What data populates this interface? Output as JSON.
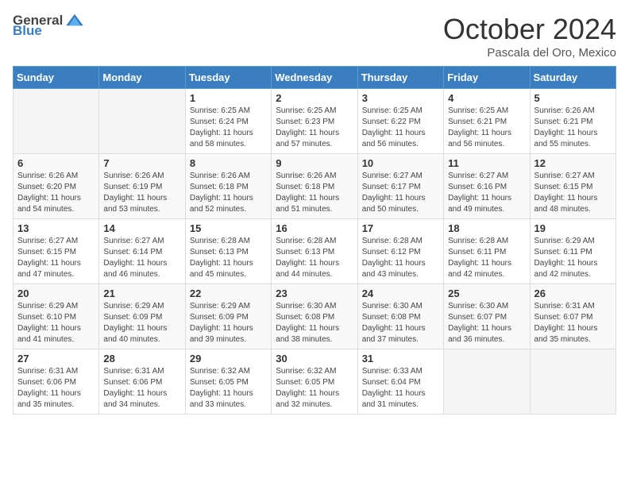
{
  "header": {
    "logo_general": "General",
    "logo_blue": "Blue",
    "month_title": "October 2024",
    "location": "Pascala del Oro, Mexico"
  },
  "days_of_week": [
    "Sunday",
    "Monday",
    "Tuesday",
    "Wednesday",
    "Thursday",
    "Friday",
    "Saturday"
  ],
  "weeks": [
    [
      {
        "day": "",
        "info": ""
      },
      {
        "day": "",
        "info": ""
      },
      {
        "day": "1",
        "info": "Sunrise: 6:25 AM\nSunset: 6:24 PM\nDaylight: 11 hours and 58 minutes."
      },
      {
        "day": "2",
        "info": "Sunrise: 6:25 AM\nSunset: 6:23 PM\nDaylight: 11 hours and 57 minutes."
      },
      {
        "day": "3",
        "info": "Sunrise: 6:25 AM\nSunset: 6:22 PM\nDaylight: 11 hours and 56 minutes."
      },
      {
        "day": "4",
        "info": "Sunrise: 6:25 AM\nSunset: 6:21 PM\nDaylight: 11 hours and 56 minutes."
      },
      {
        "day": "5",
        "info": "Sunrise: 6:26 AM\nSunset: 6:21 PM\nDaylight: 11 hours and 55 minutes."
      }
    ],
    [
      {
        "day": "6",
        "info": "Sunrise: 6:26 AM\nSunset: 6:20 PM\nDaylight: 11 hours and 54 minutes."
      },
      {
        "day": "7",
        "info": "Sunrise: 6:26 AM\nSunset: 6:19 PM\nDaylight: 11 hours and 53 minutes."
      },
      {
        "day": "8",
        "info": "Sunrise: 6:26 AM\nSunset: 6:18 PM\nDaylight: 11 hours and 52 minutes."
      },
      {
        "day": "9",
        "info": "Sunrise: 6:26 AM\nSunset: 6:18 PM\nDaylight: 11 hours and 51 minutes."
      },
      {
        "day": "10",
        "info": "Sunrise: 6:27 AM\nSunset: 6:17 PM\nDaylight: 11 hours and 50 minutes."
      },
      {
        "day": "11",
        "info": "Sunrise: 6:27 AM\nSunset: 6:16 PM\nDaylight: 11 hours and 49 minutes."
      },
      {
        "day": "12",
        "info": "Sunrise: 6:27 AM\nSunset: 6:15 PM\nDaylight: 11 hours and 48 minutes."
      }
    ],
    [
      {
        "day": "13",
        "info": "Sunrise: 6:27 AM\nSunset: 6:15 PM\nDaylight: 11 hours and 47 minutes."
      },
      {
        "day": "14",
        "info": "Sunrise: 6:27 AM\nSunset: 6:14 PM\nDaylight: 11 hours and 46 minutes."
      },
      {
        "day": "15",
        "info": "Sunrise: 6:28 AM\nSunset: 6:13 PM\nDaylight: 11 hours and 45 minutes."
      },
      {
        "day": "16",
        "info": "Sunrise: 6:28 AM\nSunset: 6:13 PM\nDaylight: 11 hours and 44 minutes."
      },
      {
        "day": "17",
        "info": "Sunrise: 6:28 AM\nSunset: 6:12 PM\nDaylight: 11 hours and 43 minutes."
      },
      {
        "day": "18",
        "info": "Sunrise: 6:28 AM\nSunset: 6:11 PM\nDaylight: 11 hours and 42 minutes."
      },
      {
        "day": "19",
        "info": "Sunrise: 6:29 AM\nSunset: 6:11 PM\nDaylight: 11 hours and 42 minutes."
      }
    ],
    [
      {
        "day": "20",
        "info": "Sunrise: 6:29 AM\nSunset: 6:10 PM\nDaylight: 11 hours and 41 minutes."
      },
      {
        "day": "21",
        "info": "Sunrise: 6:29 AM\nSunset: 6:09 PM\nDaylight: 11 hours and 40 minutes."
      },
      {
        "day": "22",
        "info": "Sunrise: 6:29 AM\nSunset: 6:09 PM\nDaylight: 11 hours and 39 minutes."
      },
      {
        "day": "23",
        "info": "Sunrise: 6:30 AM\nSunset: 6:08 PM\nDaylight: 11 hours and 38 minutes."
      },
      {
        "day": "24",
        "info": "Sunrise: 6:30 AM\nSunset: 6:08 PM\nDaylight: 11 hours and 37 minutes."
      },
      {
        "day": "25",
        "info": "Sunrise: 6:30 AM\nSunset: 6:07 PM\nDaylight: 11 hours and 36 minutes."
      },
      {
        "day": "26",
        "info": "Sunrise: 6:31 AM\nSunset: 6:07 PM\nDaylight: 11 hours and 35 minutes."
      }
    ],
    [
      {
        "day": "27",
        "info": "Sunrise: 6:31 AM\nSunset: 6:06 PM\nDaylight: 11 hours and 35 minutes."
      },
      {
        "day": "28",
        "info": "Sunrise: 6:31 AM\nSunset: 6:06 PM\nDaylight: 11 hours and 34 minutes."
      },
      {
        "day": "29",
        "info": "Sunrise: 6:32 AM\nSunset: 6:05 PM\nDaylight: 11 hours and 33 minutes."
      },
      {
        "day": "30",
        "info": "Sunrise: 6:32 AM\nSunset: 6:05 PM\nDaylight: 11 hours and 32 minutes."
      },
      {
        "day": "31",
        "info": "Sunrise: 6:33 AM\nSunset: 6:04 PM\nDaylight: 11 hours and 31 minutes."
      },
      {
        "day": "",
        "info": ""
      },
      {
        "day": "",
        "info": ""
      }
    ]
  ]
}
